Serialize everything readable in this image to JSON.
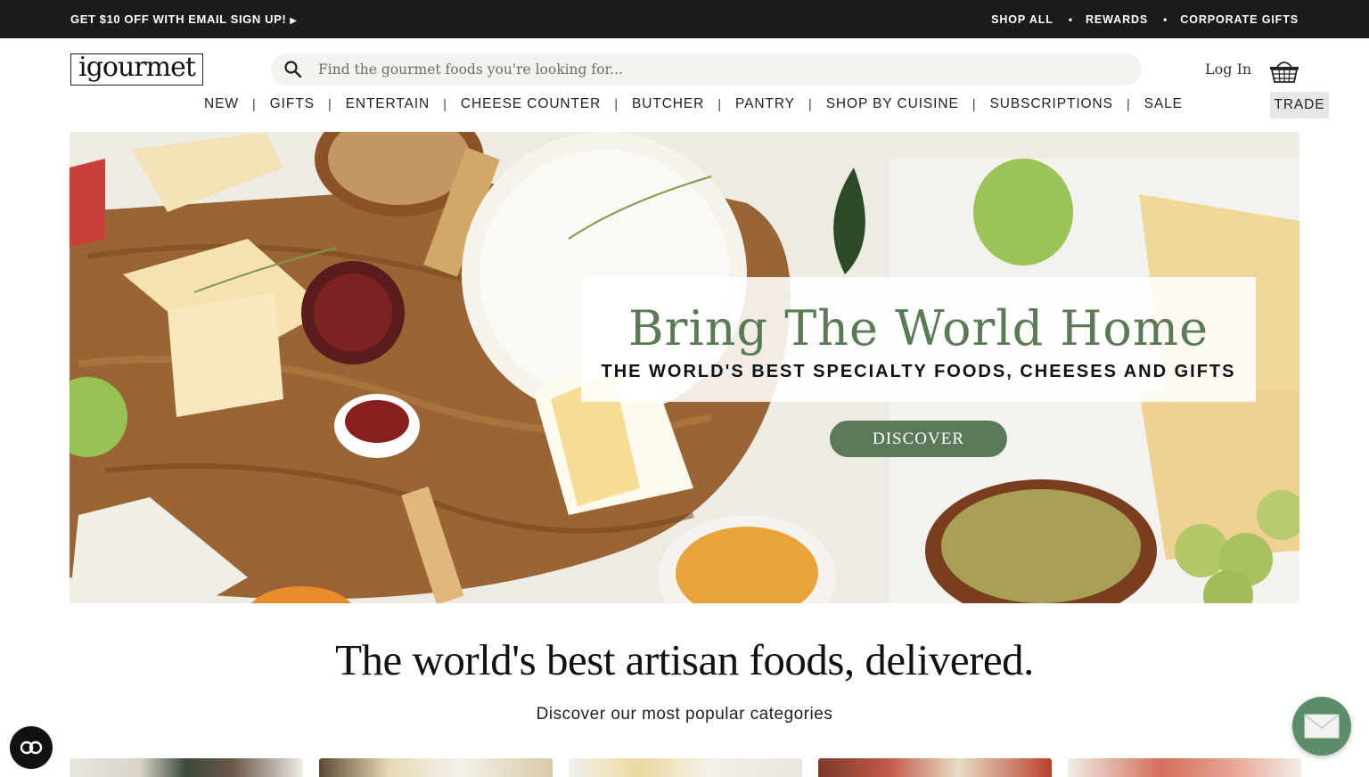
{
  "topbar": {
    "promo": "GET $10 OFF WITH EMAIL SIGN UP!",
    "promo_arrow": "▶",
    "links": [
      "SHOP ALL",
      "REWARDS",
      "CORPORATE GIFTS"
    ],
    "separator": "•"
  },
  "header": {
    "logo": "igourmet",
    "search_placeholder": "Find the gourmet foods you're looking for...",
    "login": "Log In",
    "cart_icon": "basket-icon"
  },
  "nav": {
    "items": [
      "NEW",
      "GIFTS",
      "ENTERTAIN",
      "CHEESE COUNTER",
      "BUTCHER",
      "PANTRY",
      "SHOP BY CUISINE",
      "SUBSCRIPTIONS",
      "SALE"
    ],
    "separator": "|",
    "trade": "TRADE"
  },
  "hero": {
    "title": "Bring The World Home",
    "subtitle": "THE WORLD'S BEST SPECIALTY FOODS, CHEESES AND GIFTS",
    "button": "DISCOVER"
  },
  "main": {
    "tagline": "The world's best artisan foods, delivered.",
    "subtagline": "Discover our most popular categories"
  },
  "widgets": {
    "accessibility_icon": "accessibility-icon",
    "chat_icon": "envelope-icon"
  },
  "colors": {
    "accent_green": "#5b7a5a",
    "title_green": "#5a7a55",
    "topbar": "#1c1c1c"
  }
}
